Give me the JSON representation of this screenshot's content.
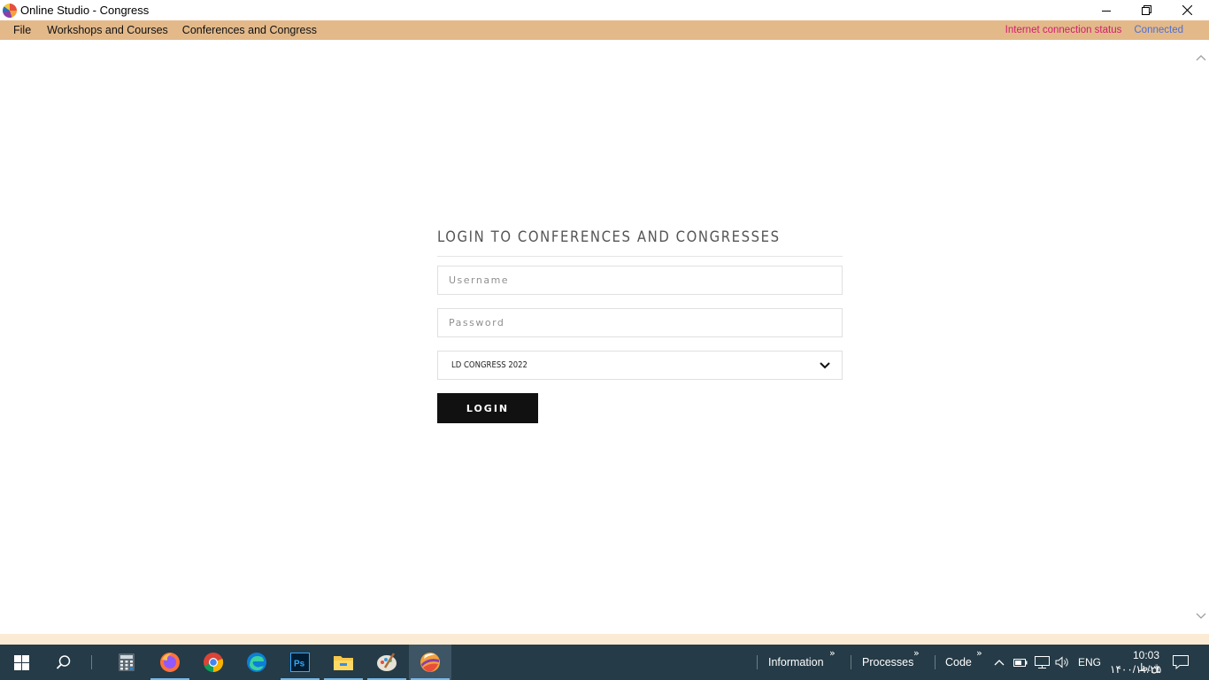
{
  "window": {
    "title": "Online Studio - Congress",
    "minimize_icon": "minimize-icon",
    "restore_icon": "restore-icon",
    "close_icon": "close-icon"
  },
  "menubar": {
    "items": [
      "File",
      "Workshops and Courses",
      "Conferences and Congress"
    ],
    "status_label": "Internet connection status",
    "status_value": "Connected",
    "colors": {
      "background": "#e3b98a",
      "status_label": "#d21c6e",
      "status_value": "#4d6fd1"
    }
  },
  "login": {
    "title": "LOGIN TO CONFERENCES AND CONGRESSES",
    "username_placeholder": "Username",
    "password_placeholder": "Password",
    "username_value": "",
    "password_value": "",
    "congress_selected": "LD CONGRESS 2022",
    "login_label": "LOGIN"
  },
  "taskbar": {
    "apps": [
      "start-icon",
      "search-icon",
      "calculator-icon",
      "firefox-icon",
      "chrome-icon",
      "edge-icon",
      "photoshop-icon",
      "file-explorer-icon",
      "paint-icon",
      "online-studio-icon"
    ],
    "toolbars": [
      "Information",
      "Processes",
      "Code"
    ],
    "language": "ENG",
    "time": "10:03 ق.ظ",
    "date": "۱۴۰۰/۱۱/۲۵",
    "ps_label": "Ps"
  }
}
